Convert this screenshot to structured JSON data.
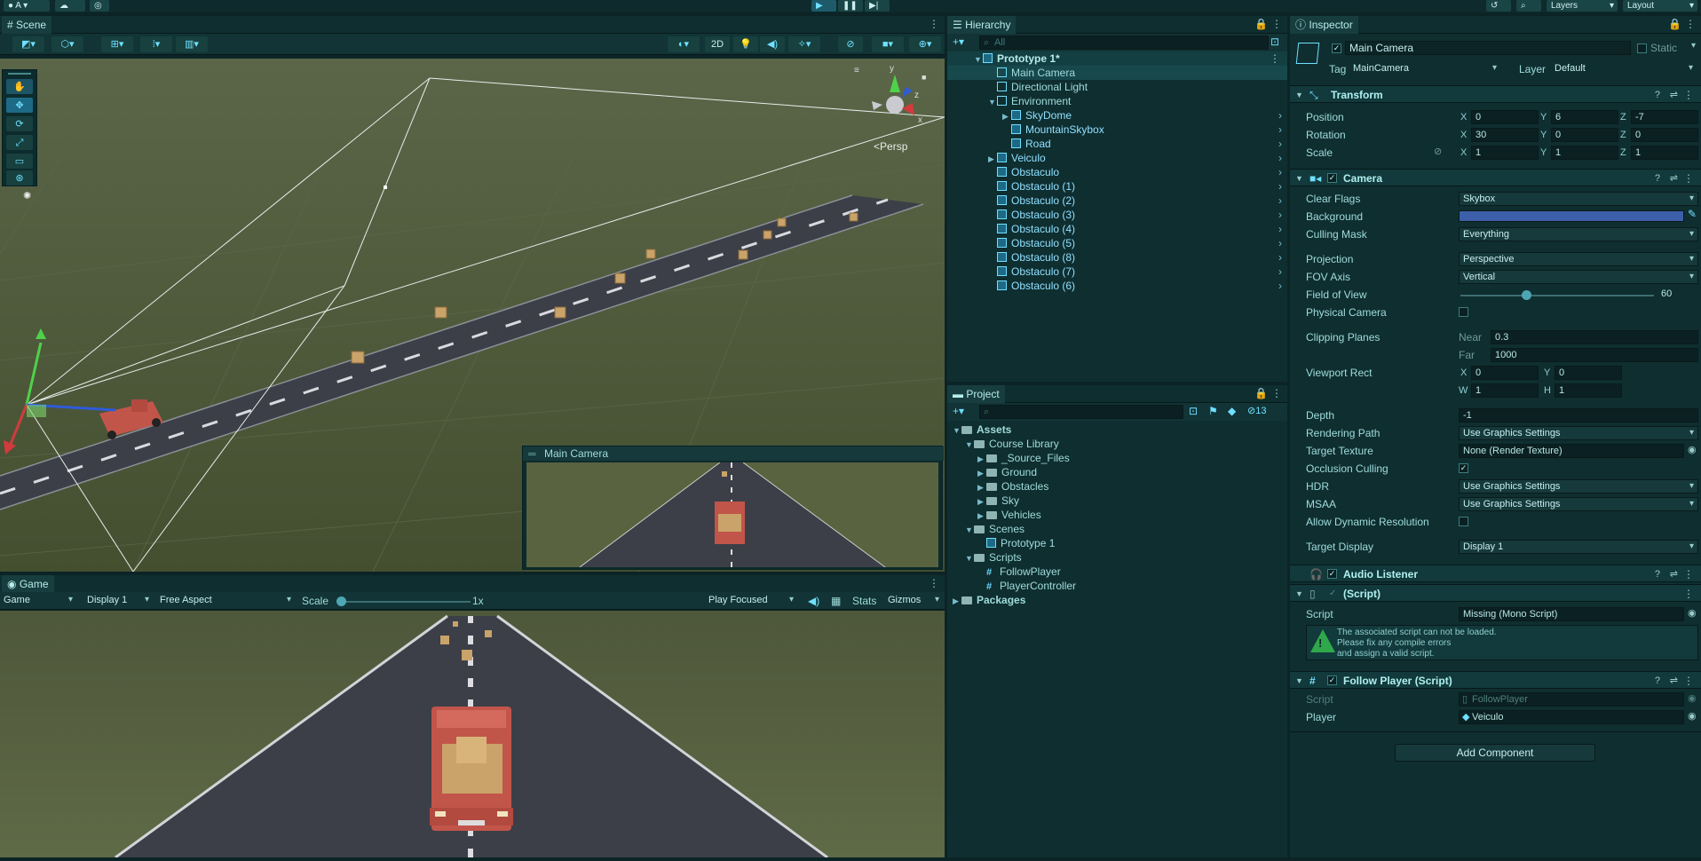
{
  "topbar": {
    "account_label": "A",
    "layers_label": "Layers",
    "layout_label": "Layout"
  },
  "scene": {
    "tab_label": "Scene",
    "toggle_2d": "2D",
    "persp_label": "Persp",
    "axis_y": "y",
    "axis_z": "z",
    "axis_x": "x",
    "camera_preview_label": "Main Camera"
  },
  "game": {
    "tab_label": "Game",
    "mode_dropdown": "Game",
    "display_dropdown": "Display 1",
    "aspect_dropdown": "Free Aspect",
    "scale_label": "Scale",
    "scale_value": "1x",
    "scale_level": 0,
    "play_mode_dropdown": "Play Focused",
    "stats_label": "Stats",
    "gizmos_label": "Gizmos"
  },
  "hierarchy": {
    "tab_label": "Hierarchy",
    "search_placeholder": "All",
    "items": [
      {
        "label": "Prototype 1*",
        "depth": 0,
        "type": "scene",
        "expanded": true
      },
      {
        "label": "Main Camera",
        "depth": 1,
        "type": "object",
        "selected": true
      },
      {
        "label": "Directional Light",
        "depth": 1,
        "type": "object"
      },
      {
        "label": "Environment",
        "depth": 1,
        "type": "object",
        "expanded": true
      },
      {
        "label": "SkyDome",
        "depth": 2,
        "type": "prefab",
        "collapsed": true
      },
      {
        "label": "MountainSkybox",
        "depth": 2,
        "type": "prefab"
      },
      {
        "label": "Road",
        "depth": 2,
        "type": "prefab"
      },
      {
        "label": "Veiculo",
        "depth": 1,
        "type": "prefab",
        "collapsed": true
      },
      {
        "label": "Obstaculo",
        "depth": 1,
        "type": "prefab"
      },
      {
        "label": "Obstaculo (1)",
        "depth": 1,
        "type": "prefab"
      },
      {
        "label": "Obstaculo (2)",
        "depth": 1,
        "type": "prefab"
      },
      {
        "label": "Obstaculo (3)",
        "depth": 1,
        "type": "prefab"
      },
      {
        "label": "Obstaculo (4)",
        "depth": 1,
        "type": "prefab"
      },
      {
        "label": "Obstaculo (5)",
        "depth": 1,
        "type": "prefab"
      },
      {
        "label": "Obstaculo (8)",
        "depth": 1,
        "type": "prefab"
      },
      {
        "label": "Obstaculo (7)",
        "depth": 1,
        "type": "prefab"
      },
      {
        "label": "Obstaculo (6)",
        "depth": 1,
        "type": "prefab"
      }
    ]
  },
  "project": {
    "tab_label": "Project",
    "hidden_count": "13",
    "tree": [
      {
        "label": "Assets",
        "depth": 0,
        "kind": "folder",
        "bold": true,
        "expanded": true
      },
      {
        "label": "Course Library",
        "depth": 1,
        "kind": "folder",
        "expanded": true
      },
      {
        "label": "_Source_Files",
        "depth": 2,
        "kind": "folder"
      },
      {
        "label": "Ground",
        "depth": 2,
        "kind": "folder"
      },
      {
        "label": "Obstacles",
        "depth": 2,
        "kind": "folder"
      },
      {
        "label": "Sky",
        "depth": 2,
        "kind": "folder"
      },
      {
        "label": "Vehicles",
        "depth": 2,
        "kind": "folder"
      },
      {
        "label": "Scenes",
        "depth": 1,
        "kind": "folder",
        "expanded": true
      },
      {
        "label": "Prototype 1",
        "depth": 2,
        "kind": "scene"
      },
      {
        "label": "Scripts",
        "depth": 1,
        "kind": "folder",
        "expanded": true
      },
      {
        "label": "FollowPlayer",
        "depth": 2,
        "kind": "script"
      },
      {
        "label": "PlayerController",
        "depth": 2,
        "kind": "script"
      },
      {
        "label": "Packages",
        "depth": 0,
        "kind": "folder",
        "bold": true
      }
    ]
  },
  "inspector": {
    "tab_label": "Inspector",
    "object_name": "Main Camera",
    "static_label": "Static",
    "tag_label": "Tag",
    "tag_value": "MainCamera",
    "layer_label": "Layer",
    "layer_value": "Default",
    "transform": {
      "title": "Transform",
      "position_label": "Position",
      "rotation_label": "Rotation",
      "scale_label": "Scale",
      "position": {
        "x": "0",
        "y": "6",
        "z": "-7"
      },
      "rotation": {
        "x": "30",
        "y": "0",
        "z": "0"
      },
      "scale": {
        "x": "1",
        "y": "1",
        "z": "1"
      }
    },
    "camera": {
      "title": "Camera",
      "clear_flags_label": "Clear Flags",
      "clear_flags": "Skybox",
      "background_label": "Background",
      "background_color": "#3d5ea8",
      "culling_mask_label": "Culling Mask",
      "culling_mask": "Everything",
      "projection_label": "Projection",
      "projection": "Perspective",
      "fov_axis_label": "FOV Axis",
      "fov_axis": "Vertical",
      "fov_label": "Field of View",
      "fov_value": "60",
      "fov_level": 0.34,
      "physical_label": "Physical Camera",
      "clipping_label": "Clipping Planes",
      "near_label": "Near",
      "near": "0.3",
      "far_label": "Far",
      "far": "1000",
      "viewport_label": "Viewport Rect",
      "vp_x": "0",
      "vp_y": "0",
      "vp_w": "1",
      "vp_h": "1",
      "depth_label": "Depth",
      "depth": "-1",
      "rendering_path_label": "Rendering Path",
      "rendering_path": "Use Graphics Settings",
      "target_texture_label": "Target Texture",
      "target_texture": "None (Render Texture)",
      "occlusion_label": "Occlusion Culling",
      "hdr_label": "HDR",
      "hdr": "Use Graphics Settings",
      "msaa_label": "MSAA",
      "msaa": "Use Graphics Settings",
      "dynres_label": "Allow Dynamic Resolution",
      "target_display_label": "Target Display",
      "target_display": "Display 1"
    },
    "audio_listener": {
      "title": "Audio Listener"
    },
    "missing_script": {
      "title": "(Script)",
      "script_label": "Script",
      "script_value": "Missing (Mono Script)",
      "warning_line1": "The associated script can not be loaded.",
      "warning_line2": "Please fix any compile errors",
      "warning_line3": "and assign a valid script."
    },
    "follow_player": {
      "title": "Follow Player (Script)",
      "script_label": "Script",
      "script_value": "FollowPlayer",
      "player_label": "Player",
      "player_value": "Veiculo"
    },
    "add_component": "Add Component"
  },
  "colors": {
    "accent": "#6fe0ff",
    "panel_bg": "#0f2e30",
    "warning": "#2ea84a"
  }
}
